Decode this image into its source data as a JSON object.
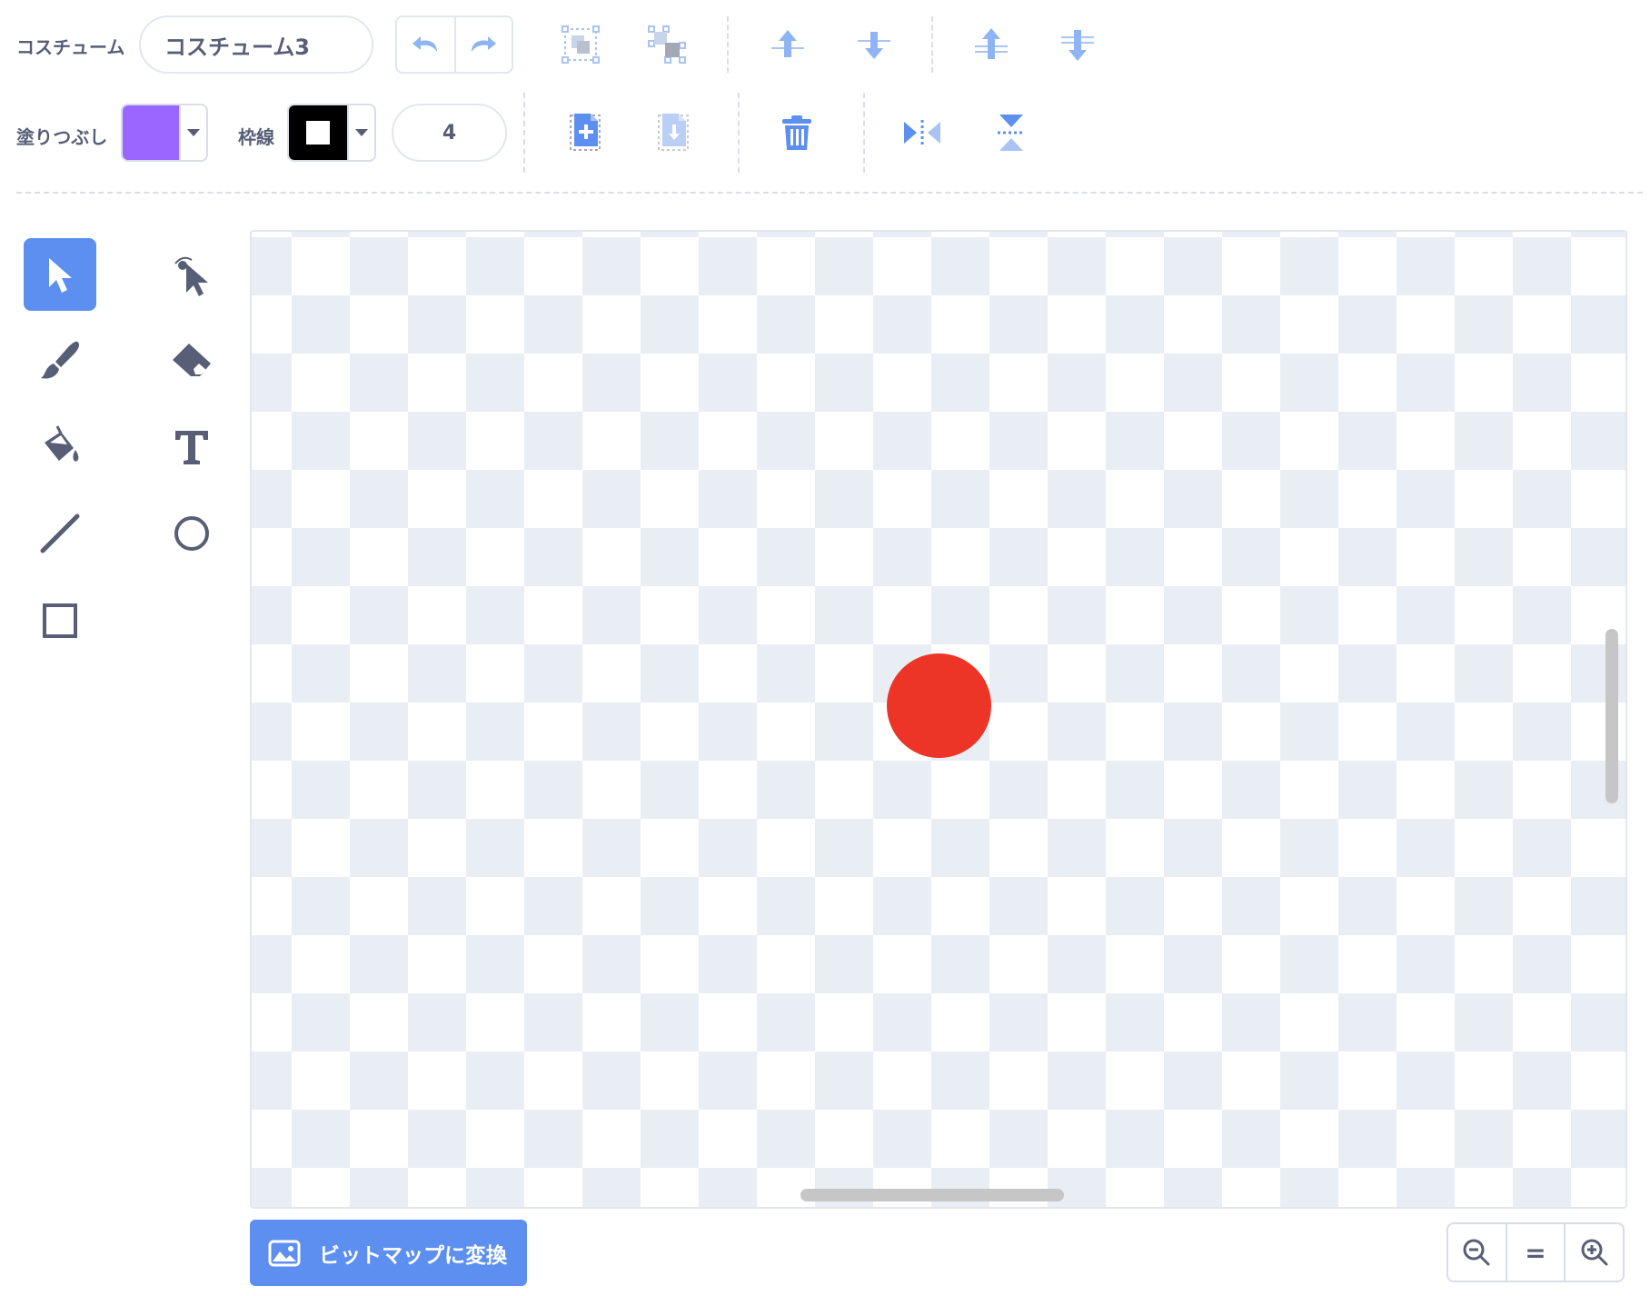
{
  "toolbar": {
    "costume_label": "コスチューム",
    "costume_name": "コスチューム3",
    "fill_label": "塗りつぶし",
    "fill_color": "#9966ff",
    "outline_label": "枠線",
    "outline_color": "#000000",
    "outline_width": "4"
  },
  "canvas": {
    "circle_color": "#ec3527"
  },
  "convert_button": {
    "label": "ビットマップに変換"
  },
  "zoom": {
    "reset_label": "="
  },
  "colors": {
    "accent": "#5c8ff0",
    "text": "#575e75",
    "checker": "#e9eef5"
  }
}
